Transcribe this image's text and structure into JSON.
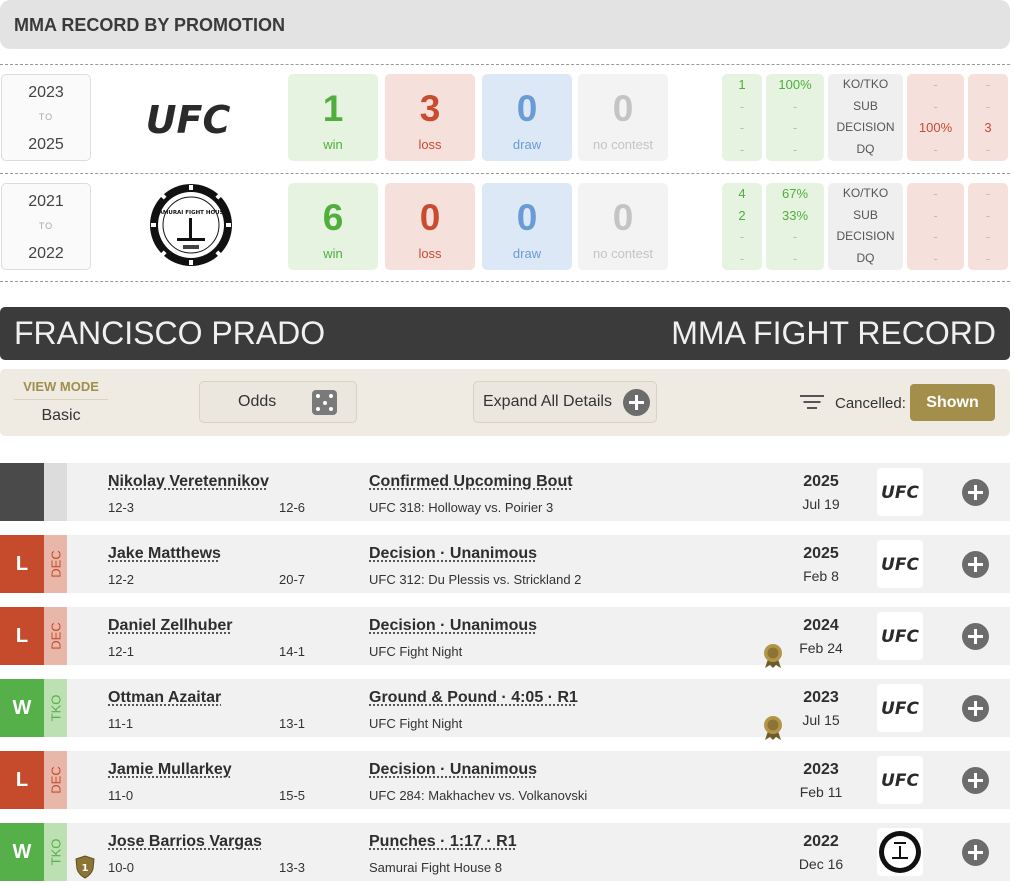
{
  "promotion_section": {
    "title": "MMA RECORD BY PROMOTION",
    "rows": [
      {
        "from": "2023",
        "to_word": "TO",
        "to": "2025",
        "logo": "ufc-logo",
        "win": "1",
        "win_label": "win",
        "loss": "3",
        "loss_label": "loss",
        "draw": "0",
        "draw_label": "draw",
        "nc": "0",
        "nc_label": "no contest",
        "methods": [
          "KO/TKO",
          "SUB",
          "DECISION",
          "DQ"
        ],
        "win_counts": [
          "1",
          "-",
          "-",
          "-"
        ],
        "win_pcts": [
          "100%",
          "-",
          "-",
          "-"
        ],
        "loss_pcts": [
          "-",
          "-",
          "100%",
          "-"
        ],
        "loss_counts": [
          "-",
          "-",
          "3",
          "-"
        ]
      },
      {
        "from": "2021",
        "to_word": "TO",
        "to": "2022",
        "logo": "samurai-fight-house-logo",
        "logo_text": "SAMURAI FIGHT HOUSE",
        "win": "6",
        "win_label": "win",
        "loss": "0",
        "loss_label": "loss",
        "draw": "0",
        "draw_label": "draw",
        "nc": "0",
        "nc_label": "no contest",
        "methods": [
          "KO/TKO",
          "SUB",
          "DECISION",
          "DQ"
        ],
        "win_counts": [
          "4",
          "2",
          "-",
          "-"
        ],
        "win_pcts": [
          "67%",
          "33%",
          "-",
          "-"
        ],
        "loss_pcts": [
          "-",
          "-",
          "-",
          "-"
        ],
        "loss_counts": [
          "-",
          "-",
          "-",
          "-"
        ]
      }
    ]
  },
  "banner": {
    "name": "FRANCISCO PRADO",
    "title": "MMA FIGHT RECORD"
  },
  "controls": {
    "view_mode_label": "VIEW MODE",
    "view_mode_value": "Basic",
    "odds_label": "Odds",
    "expand_label": "Expand All Details",
    "cancelled_label": "Cancelled:",
    "shown_label": "Shown"
  },
  "fights": [
    {
      "result": "",
      "method_short": "",
      "opponent": "Nikolay Veretennikov",
      "record": "12-3",
      "opp_record": "12-6",
      "method": "Confirmed Upcoming Bout",
      "event": "UFC 318: Holloway vs. Poirier 3",
      "year": "2025",
      "date": "Jul 19",
      "logo": "ufc-logo"
    },
    {
      "result": "L",
      "method_short": "DEC",
      "opponent": "Jake Matthews",
      "record": "12-2",
      "opp_record": "20-7",
      "method": "Decision · Unanimous",
      "event": "UFC 312: Du Plessis vs. Strickland 2",
      "year": "2025",
      "date": "Feb 8",
      "logo": "ufc-logo"
    },
    {
      "result": "L",
      "method_short": "DEC",
      "opponent": "Daniel Zellhuber",
      "record": "12-1",
      "opp_record": "14-1",
      "method": "Decision · Unanimous",
      "event": "UFC Fight Night",
      "year": "2024",
      "date": "Feb 24",
      "logo": "ufc-logo",
      "medal": "bonus-medal-icon"
    },
    {
      "result": "W",
      "method_short": "TKO",
      "opponent": "Ottman Azaitar",
      "record": "11-1",
      "opp_record": "13-1",
      "method": "Ground & Pound · 4:05 · R1",
      "event": "UFC Fight Night",
      "year": "2023",
      "date": "Jul 15",
      "logo": "ufc-logo",
      "medal": "bonus-medal-icon"
    },
    {
      "result": "L",
      "method_short": "DEC",
      "opponent": "Jamie Mullarkey",
      "record": "11-0",
      "opp_record": "15-5",
      "method": "Decision · Unanimous",
      "event": "UFC 284: Makhachev vs. Volkanovski",
      "year": "2023",
      "date": "Feb 11",
      "logo": "ufc-logo"
    },
    {
      "result": "W",
      "method_short": "TKO",
      "opponent": "Jose Barrios Vargas",
      "record": "10-0",
      "opp_record": "13-3",
      "method": "Punches · 1:17 · R1",
      "event": "Samurai Fight House 8",
      "year": "2022",
      "date": "Dec 16",
      "logo": "samurai-fight-house-logo",
      "badge": "1"
    }
  ],
  "logo_text": {
    "ufc": "UFC"
  },
  "colors": {
    "win": "#56b04a",
    "loss": "#c54b2c",
    "draw": "#6a9bd5",
    "accent": "#a48e4c",
    "banner": "#3b3b3b"
  }
}
